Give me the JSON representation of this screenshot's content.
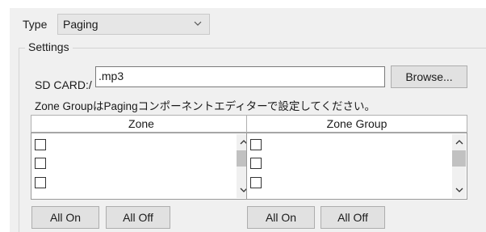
{
  "type_field": {
    "label": "Type",
    "value": "Paging"
  },
  "settings": {
    "title": "Settings",
    "sd_card": {
      "label": "SD CARD:/",
      "value": ".mp3"
    },
    "browse_label": "Browse...",
    "note": "Zone GroupはPagingコンポーネントエディターで設定してください。"
  },
  "zone_list": {
    "header": "Zone",
    "rows": [
      {
        "checked": false
      },
      {
        "checked": false
      },
      {
        "checked": false
      }
    ],
    "all_on": "All On",
    "all_off": "All Off"
  },
  "zone_group_list": {
    "header": "Zone Group",
    "rows": [
      {
        "checked": false
      },
      {
        "checked": false
      },
      {
        "checked": false
      }
    ],
    "all_on": "All On",
    "all_off": "All Off"
  }
}
